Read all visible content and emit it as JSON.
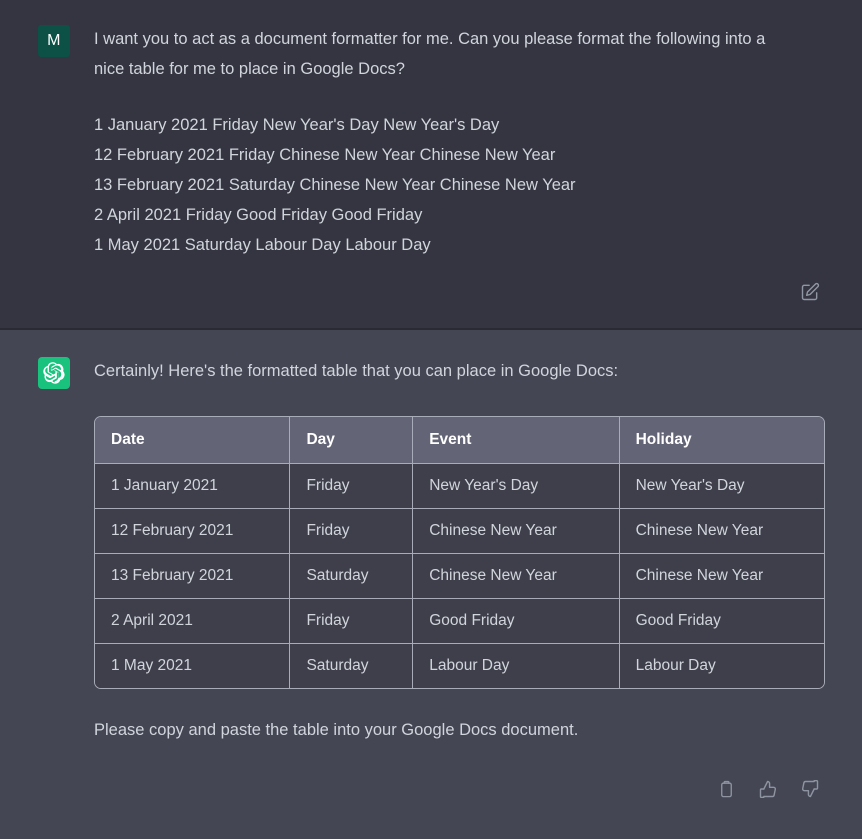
{
  "user_message": {
    "avatar_initial": "M",
    "avatar_name": "user-avatar",
    "prompt": "I want you to act as a document formatter for me. Can you please format the following into a nice table for me to place in Google Docs?",
    "input_lines": [
      "1 January 2021 Friday New Year's Day New Year's Day",
      "12 February 2021 Friday Chinese New Year Chinese New Year",
      "13 February 2021 Saturday Chinese New Year Chinese New Year",
      "2 April 2021 Friday Good Friday Good Friday",
      "1 May 2021 Saturday Labour Day Labour Day"
    ],
    "edit_icon": "edit-pencil-square-icon"
  },
  "assistant_message": {
    "avatar_icon": "openai-logo-icon",
    "intro": "Certainly! Here's the formatted table that you can place in Google Docs:",
    "outro": "Please copy and paste the table into your Google Docs document.",
    "table": {
      "headers": [
        "Date",
        "Day",
        "Event",
        "Holiday"
      ],
      "rows": [
        [
          "1 January 2021",
          "Friday",
          "New Year's Day",
          "New Year's Day"
        ],
        [
          "12 February 2021",
          "Friday",
          "Chinese New Year",
          "Chinese New Year"
        ],
        [
          "13 February 2021",
          "Saturday",
          "Chinese New Year",
          "Chinese New Year"
        ],
        [
          "2 April 2021",
          "Friday",
          "Good Friday",
          "Good Friday"
        ],
        [
          "1 May 2021",
          "Saturday",
          "Labour Day",
          "Labour Day"
        ]
      ]
    },
    "actions": [
      {
        "name": "copy-icon",
        "label": "Copy"
      },
      {
        "name": "thumbs-up-icon",
        "label": "Good response"
      },
      {
        "name": "thumbs-down-icon",
        "label": "Bad response"
      }
    ]
  },
  "colors": {
    "user_background": "#343541",
    "assistant_background": "#444654",
    "divider": "#2a2b32",
    "text": "#d1d5db",
    "user_avatar_green": "#0c5046",
    "assistant_avatar_green": "#19c37d",
    "table_border": "#a8acb8",
    "table_header_background": "#636577",
    "table_cell_background": "#3e3f4b"
  }
}
